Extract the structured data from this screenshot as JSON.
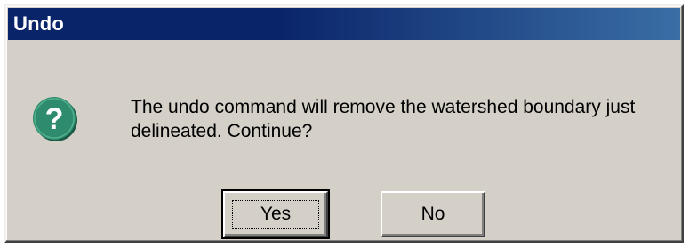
{
  "window": {
    "title": "Undo"
  },
  "dialog": {
    "icon": "question-icon",
    "icon_color": "#2e8b6e",
    "message_line1": "The undo command will remove the watershed boundary just",
    "message_line2": "delineated. Continue?"
  },
  "buttons": {
    "yes_label": "Yes",
    "no_label": "No"
  },
  "colors": {
    "titlebar": "#0a246a",
    "face": "#d4d0c8"
  }
}
